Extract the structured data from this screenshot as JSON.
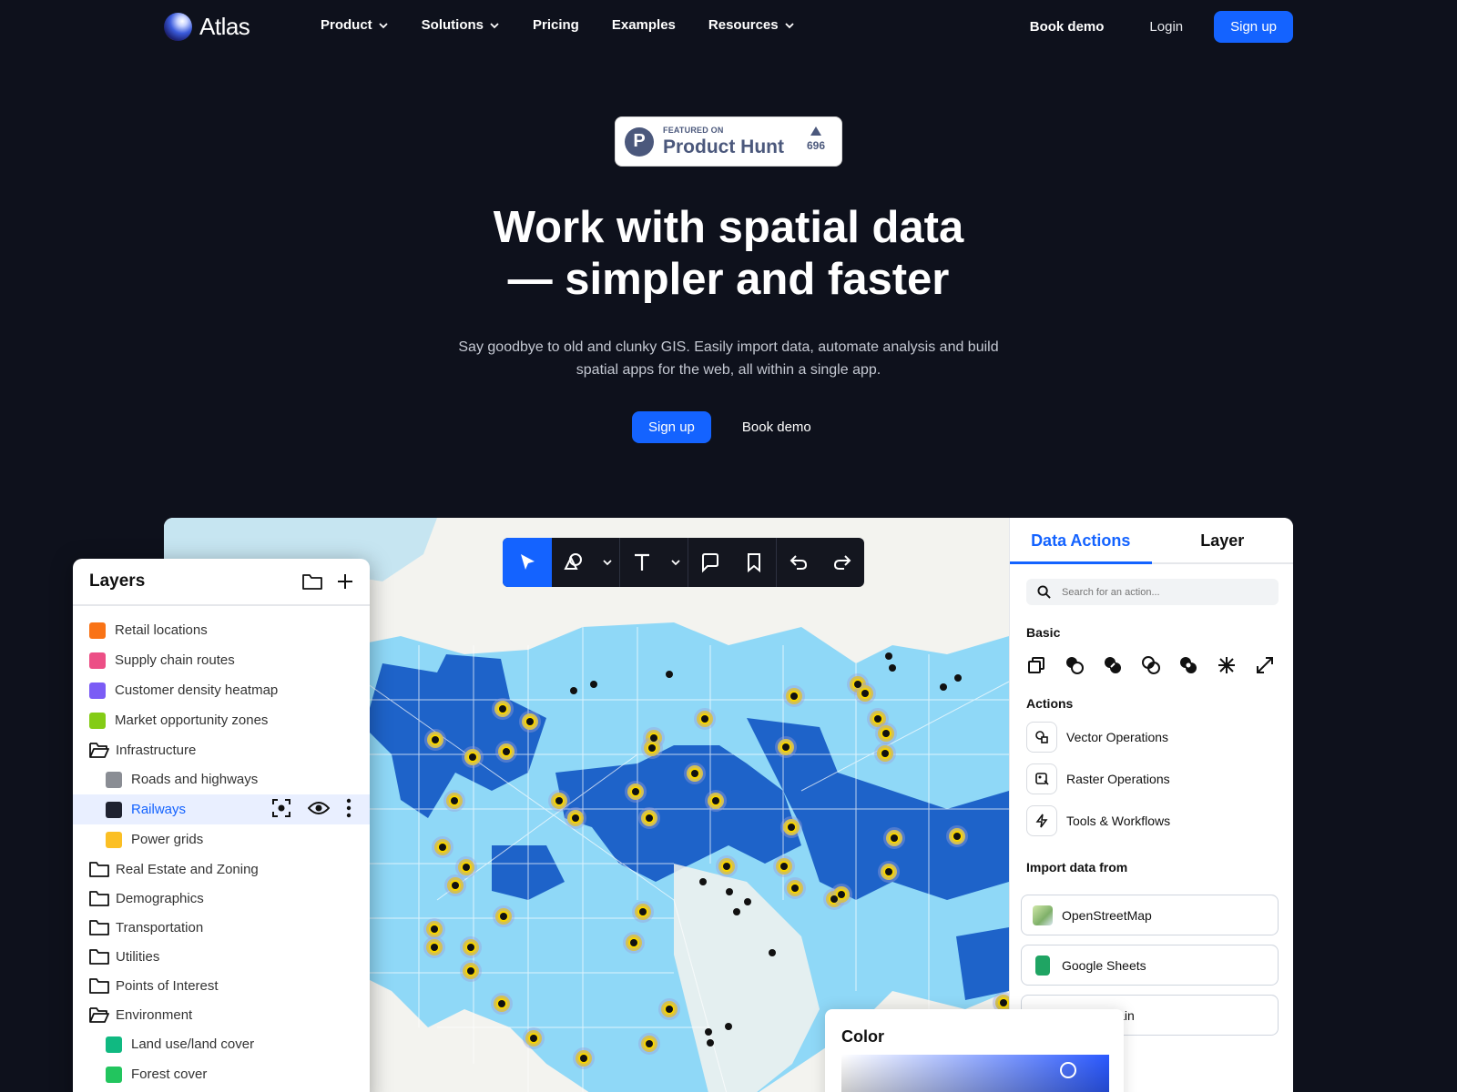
{
  "brand": {
    "name": "Atlas"
  },
  "nav": {
    "links": [
      {
        "label": "Product",
        "dropdown": true
      },
      {
        "label": "Solutions",
        "dropdown": true
      },
      {
        "label": "Pricing",
        "dropdown": false
      },
      {
        "label": "Examples",
        "dropdown": false
      },
      {
        "label": "Resources",
        "dropdown": true
      }
    ],
    "book_demo": "Book demo",
    "login": "Login",
    "signup": "Sign up"
  },
  "badge": {
    "featured": "FEATURED ON",
    "name": "Product Hunt",
    "votes": "696",
    "letter": "P"
  },
  "hero": {
    "title_line1": "Work with spatial data",
    "title_line2": "— simpler and faster",
    "subtitle": "Say goodbye to old and clunky GIS. Easily import data, automate analysis and build spatial apps for the web, all within a single app.",
    "signup": "Sign up",
    "book_demo": "Book demo"
  },
  "toolbar": {
    "tools": [
      "select-tool",
      "shape-tool",
      "text-tool",
      "comment-tool",
      "bookmark-tool",
      "undo",
      "redo"
    ]
  },
  "right_panel": {
    "tabs": [
      "Data Actions",
      "Layer"
    ],
    "search_placeholder": "Search for an action...",
    "basic_title": "Basic",
    "basic_icons": [
      "copy-icon",
      "union-icon",
      "difference-icon",
      "intersect-icon",
      "symmetric-difference-icon",
      "split-icon",
      "expand-icon"
    ],
    "actions_title": "Actions",
    "actions": [
      "Vector Operations",
      "Raster Operations",
      "Tools & Workflows"
    ],
    "import_title": "Import data from",
    "imports": [
      "OpenStreetMap",
      "Google Sheets",
      "errain"
    ]
  },
  "layers": {
    "title": "Layers",
    "items": [
      {
        "label": "Retail locations",
        "type": "layer",
        "color": "#f97316",
        "indent": false
      },
      {
        "label": "Supply chain routes",
        "type": "layer",
        "color": "#ec4f86",
        "indent": false
      },
      {
        "label": "Customer density heatmap",
        "type": "layer",
        "color": "#7b5cf5",
        "indent": false
      },
      {
        "label": "Market opportunity zones",
        "type": "layer",
        "color": "#84cc16",
        "indent": false
      },
      {
        "label": "Infrastructure",
        "type": "folder-open",
        "indent": false
      },
      {
        "label": "Roads and highways",
        "type": "layer",
        "color": "#8a8d94",
        "indent": true
      },
      {
        "label": "Railways",
        "type": "layer",
        "color": "#1f2230",
        "indent": true,
        "selected": true
      },
      {
        "label": "Power grids",
        "type": "layer",
        "color": "#fbbf24",
        "indent": true
      },
      {
        "label": "Real Estate and Zoning",
        "type": "folder",
        "indent": false
      },
      {
        "label": "Demographics",
        "type": "folder",
        "indent": false
      },
      {
        "label": "Transportation",
        "type": "folder",
        "indent": false
      },
      {
        "label": "Utilities",
        "type": "folder",
        "indent": false
      },
      {
        "label": "Points of Interest",
        "type": "folder",
        "indent": false
      },
      {
        "label": "Environment",
        "type": "folder-open",
        "indent": false
      },
      {
        "label": "Land use/land cover",
        "type": "layer",
        "color": "#10b981",
        "indent": true
      },
      {
        "label": "Forest cover",
        "type": "layer",
        "color": "#22c55e",
        "indent": true
      }
    ]
  },
  "color_picker": {
    "title": "Color"
  },
  "colors": {
    "accent": "#1463ff",
    "background": "#0e111c",
    "map_light": "#8fd8f7",
    "map_dark": "#1e63c9",
    "marker": "#f8d500"
  }
}
